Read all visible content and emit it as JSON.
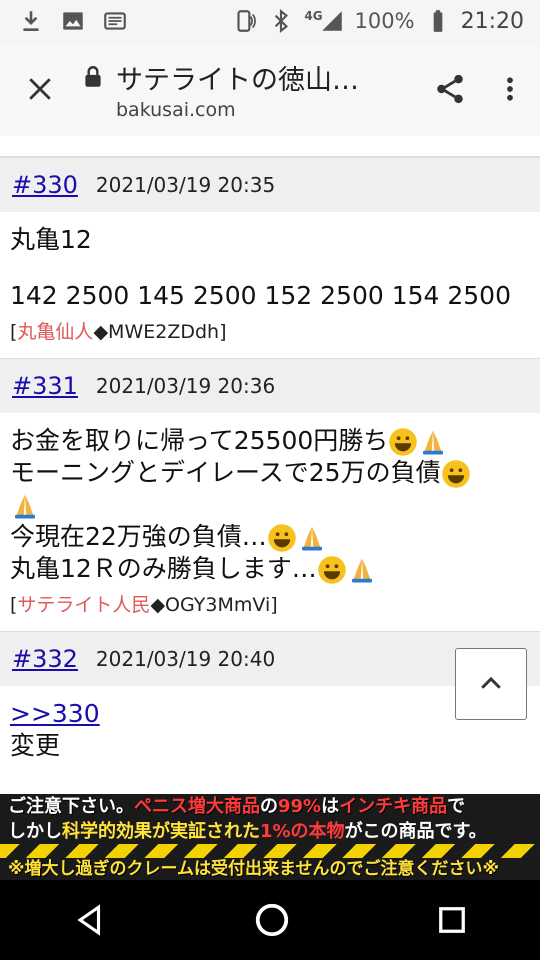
{
  "status_bar": {
    "battery": "100%",
    "time": "21:20",
    "network": "4G"
  },
  "browser": {
    "page_title": "サテライトの徳山…",
    "domain": "bakusai.com"
  },
  "posts": [
    {
      "number": "#330",
      "date": "2021/03/19 20:35",
      "lines": [
        "丸亀12",
        "",
        "142 2500 145 2500 152 2500 154 2500"
      ],
      "author_name": "丸亀仙人",
      "author_id": "◆MWE2ZDdh]"
    },
    {
      "number": "#331",
      "date": "2021/03/19 20:36",
      "lines": [
        "お金を取りに帰って25500円勝ち",
        "モーニングとデイレースで25万の負債",
        "今現在22万強の負債…",
        "丸亀12Ｒのみ勝負します…"
      ],
      "author_name": "サテライト人民",
      "author_id": "◆OGY3MmVi]"
    },
    {
      "number": "#332",
      "date": "2021/03/19 20:40",
      "reply": ">>330",
      "lines": [
        "変更"
      ]
    }
  ],
  "banner": {
    "line1_a": "ご注意下さい。",
    "line1_b": "ペニス増大商品",
    "line1_c": "の",
    "line1_d": "99%",
    "line1_e": "は",
    "line1_f": "インチキ商品",
    "line1_g": "で",
    "line2_a": "しかし",
    "line2_b": "科学的効果が実証された",
    "line2_c": "1%の本物",
    "line2_d": "がこの商品です。",
    "line3": "※増大し過ぎのクレームは受付出来ませんのでご注意ください※"
  },
  "icons": {
    "download": "download-icon",
    "image": "image-icon",
    "cast": "cast-icon",
    "nfc": "nfc-icon",
    "bluetooth": "bluetooth-icon",
    "signal": "signal-icon",
    "battery": "battery-icon",
    "close": "close-icon",
    "lock": "lock-icon",
    "share": "share-icon",
    "menu": "more-vert-icon",
    "scroll_top": "chevron-up-icon",
    "back": "back-triangle-icon",
    "home": "home-circle-icon",
    "recents": "recents-square-icon"
  }
}
